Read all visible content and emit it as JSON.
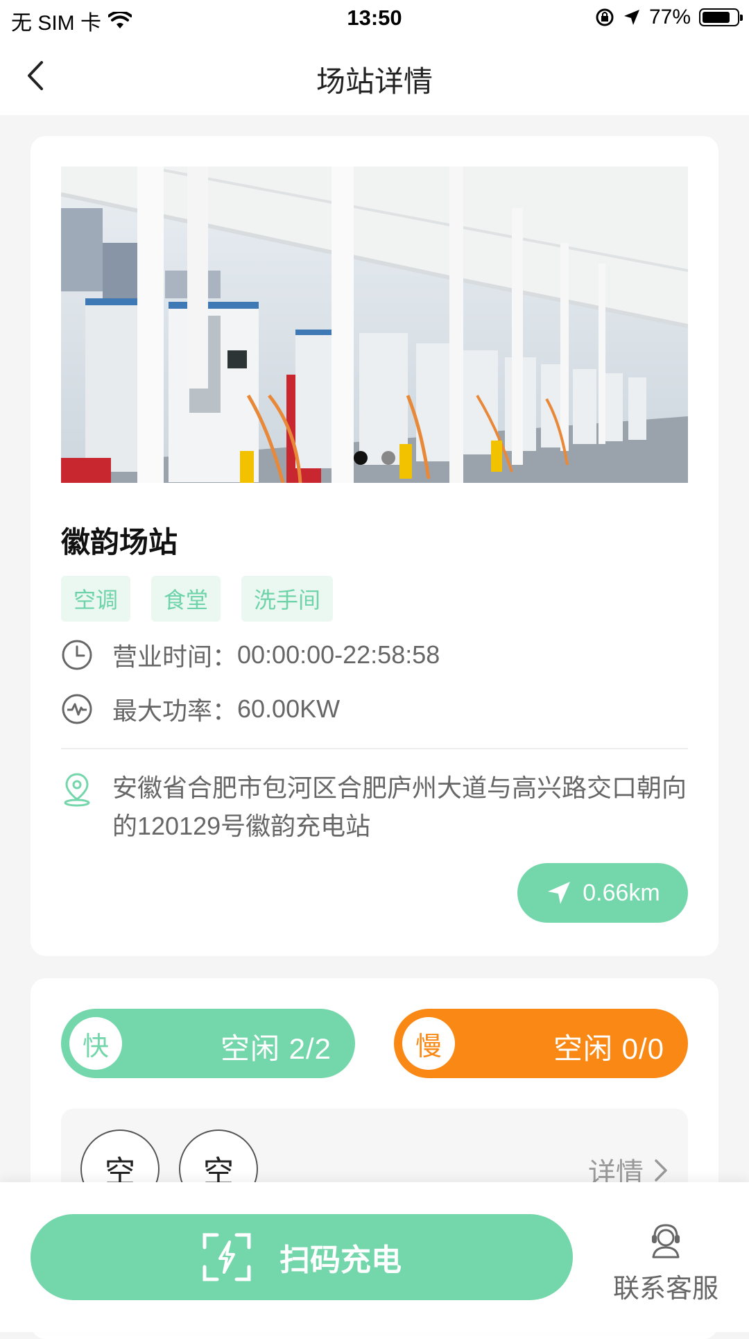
{
  "status_bar": {
    "carrier": "无 SIM 卡",
    "time": "13:50",
    "battery": "77%"
  },
  "nav": {
    "title": "场站详情"
  },
  "station": {
    "name": "徽韵场站",
    "tags": [
      "空调",
      "食堂",
      "洗手间"
    ],
    "hours_label": "营业时间：",
    "hours_value": "00:00:00-22:58:58",
    "power_label": "最大功率：",
    "power_value": "60.00KW",
    "address": "安徽省合肥市包河区合肥庐州大道与高兴路交口朝向的120129号徽韵充电站",
    "distance": "0.66km",
    "banner_total": 2,
    "banner_active": 1
  },
  "chargers": {
    "fast": {
      "badge": "快",
      "status": "空闲 2/2"
    },
    "slow": {
      "badge": "慢",
      "status": "空闲 0/0"
    },
    "slots": [
      "空",
      "空"
    ],
    "detail_label": "详情"
  },
  "bottom": {
    "scan_label": "扫码充电",
    "service_label": "联系客服"
  },
  "colors": {
    "accent": "#74d6ab",
    "orange": "#f98815",
    "tag_bg": "#eaf8f1"
  }
}
